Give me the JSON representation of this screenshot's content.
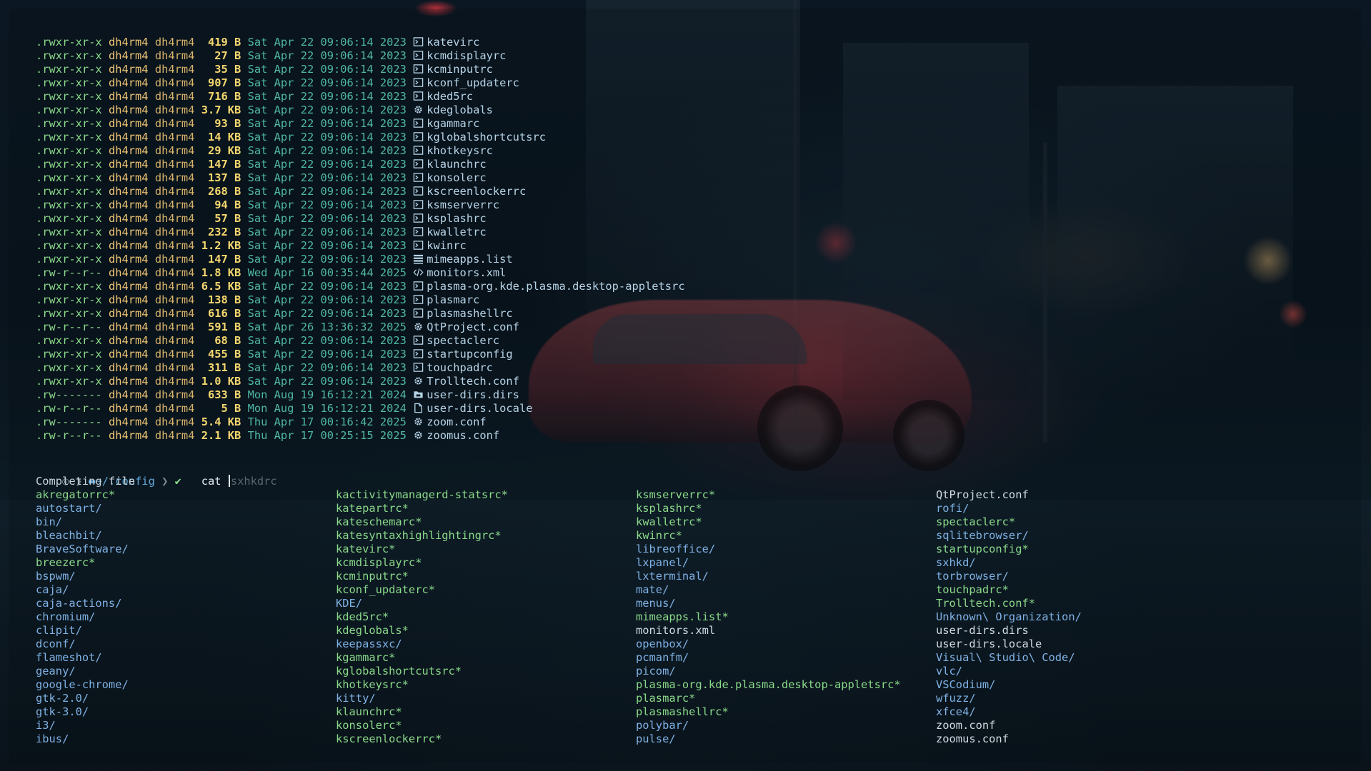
{
  "listing": [
    {
      "perm": ".rwxr-xr-x",
      "user": "dh4rm4",
      "group": "dh4rm4",
      "size": "419 B",
      "date": "Sat Apr 22 09:06:14 2023",
      "icon": "terminal-file-icon",
      "name": "katevirc"
    },
    {
      "perm": ".rwxr-xr-x",
      "user": "dh4rm4",
      "group": "dh4rm4",
      "size": " 27 B",
      "date": "Sat Apr 22 09:06:14 2023",
      "icon": "terminal-file-icon",
      "name": "kcmdisplayrc"
    },
    {
      "perm": ".rwxr-xr-x",
      "user": "dh4rm4",
      "group": "dh4rm4",
      "size": " 35 B",
      "date": "Sat Apr 22 09:06:14 2023",
      "icon": "terminal-file-icon",
      "name": "kcminputrc"
    },
    {
      "perm": ".rwxr-xr-x",
      "user": "dh4rm4",
      "group": "dh4rm4",
      "size": "907 B",
      "date": "Sat Apr 22 09:06:14 2023",
      "icon": "terminal-file-icon",
      "name": "kconf_updaterc"
    },
    {
      "perm": ".rwxr-xr-x",
      "user": "dh4rm4",
      "group": "dh4rm4",
      "size": "716 B",
      "date": "Sat Apr 22 09:06:14 2023",
      "icon": "terminal-file-icon",
      "name": "kded5rc"
    },
    {
      "perm": ".rwxr-xr-x",
      "user": "dh4rm4",
      "group": "dh4rm4",
      "size": "3.7 KB",
      "date": "Sat Apr 22 09:06:14 2023",
      "icon": "gear-icon",
      "name": "kdeglobals"
    },
    {
      "perm": ".rwxr-xr-x",
      "user": "dh4rm4",
      "group": "dh4rm4",
      "size": " 93 B",
      "date": "Sat Apr 22 09:06:14 2023",
      "icon": "terminal-file-icon",
      "name": "kgammarc"
    },
    {
      "perm": ".rwxr-xr-x",
      "user": "dh4rm4",
      "group": "dh4rm4",
      "size": " 14 KB",
      "date": "Sat Apr 22 09:06:14 2023",
      "icon": "terminal-file-icon",
      "name": "kglobalshortcutsrc"
    },
    {
      "perm": ".rwxr-xr-x",
      "user": "dh4rm4",
      "group": "dh4rm4",
      "size": " 29 KB",
      "date": "Sat Apr 22 09:06:14 2023",
      "icon": "terminal-file-icon",
      "name": "khotkeysrc"
    },
    {
      "perm": ".rwxr-xr-x",
      "user": "dh4rm4",
      "group": "dh4rm4",
      "size": "147 B",
      "date": "Sat Apr 22 09:06:14 2023",
      "icon": "terminal-file-icon",
      "name": "klaunchrc"
    },
    {
      "perm": ".rwxr-xr-x",
      "user": "dh4rm4",
      "group": "dh4rm4",
      "size": "137 B",
      "date": "Sat Apr 22 09:06:14 2023",
      "icon": "terminal-file-icon",
      "name": "konsolerc"
    },
    {
      "perm": ".rwxr-xr-x",
      "user": "dh4rm4",
      "group": "dh4rm4",
      "size": "268 B",
      "date": "Sat Apr 22 09:06:14 2023",
      "icon": "terminal-file-icon",
      "name": "kscreenlockerrc"
    },
    {
      "perm": ".rwxr-xr-x",
      "user": "dh4rm4",
      "group": "dh4rm4",
      "size": " 94 B",
      "date": "Sat Apr 22 09:06:14 2023",
      "icon": "terminal-file-icon",
      "name": "ksmserverrc"
    },
    {
      "perm": ".rwxr-xr-x",
      "user": "dh4rm4",
      "group": "dh4rm4",
      "size": " 57 B",
      "date": "Sat Apr 22 09:06:14 2023",
      "icon": "terminal-file-icon",
      "name": "ksplashrc"
    },
    {
      "perm": ".rwxr-xr-x",
      "user": "dh4rm4",
      "group": "dh4rm4",
      "size": "232 B",
      "date": "Sat Apr 22 09:06:14 2023",
      "icon": "terminal-file-icon",
      "name": "kwalletrc"
    },
    {
      "perm": ".rwxr-xr-x",
      "user": "dh4rm4",
      "group": "dh4rm4",
      "size": "1.2 KB",
      "date": "Sat Apr 22 09:06:14 2023",
      "icon": "terminal-file-icon",
      "name": "kwinrc"
    },
    {
      "perm": ".rwxr-xr-x",
      "user": "dh4rm4",
      "group": "dh4rm4",
      "size": "147 B",
      "date": "Sat Apr 22 09:06:14 2023",
      "icon": "list-icon",
      "name": "mimeapps.list"
    },
    {
      "perm": ".rw-r--r--",
      "user": "dh4rm4",
      "group": "dh4rm4",
      "size": "1.8 KB",
      "date": "Wed Apr 16 00:35:44 2025",
      "icon": "code-icon",
      "name": "monitors.xml"
    },
    {
      "perm": ".rwxr-xr-x",
      "user": "dh4rm4",
      "group": "dh4rm4",
      "size": "6.5 KB",
      "date": "Sat Apr 22 09:06:14 2023",
      "icon": "terminal-file-icon",
      "name": "plasma-org.kde.plasma.desktop-appletsrc"
    },
    {
      "perm": ".rwxr-xr-x",
      "user": "dh4rm4",
      "group": "dh4rm4",
      "size": "138 B",
      "date": "Sat Apr 22 09:06:14 2023",
      "icon": "terminal-file-icon",
      "name": "plasmarc"
    },
    {
      "perm": ".rwxr-xr-x",
      "user": "dh4rm4",
      "group": "dh4rm4",
      "size": "616 B",
      "date": "Sat Apr 22 09:06:14 2023",
      "icon": "terminal-file-icon",
      "name": "plasmashellrc"
    },
    {
      "perm": ".rw-r--r--",
      "user": "dh4rm4",
      "group": "dh4rm4",
      "size": "591 B",
      "date": "Sat Apr 26 13:36:32 2025",
      "icon": "gear-icon",
      "name": "QtProject.conf"
    },
    {
      "perm": ".rwxr-xr-x",
      "user": "dh4rm4",
      "group": "dh4rm4",
      "size": " 68 B",
      "date": "Sat Apr 22 09:06:14 2023",
      "icon": "terminal-file-icon",
      "name": "spectaclerc"
    },
    {
      "perm": ".rwxr-xr-x",
      "user": "dh4rm4",
      "group": "dh4rm4",
      "size": "455 B",
      "date": "Sat Apr 22 09:06:14 2023",
      "icon": "terminal-file-icon",
      "name": "startupconfig"
    },
    {
      "perm": ".rwxr-xr-x",
      "user": "dh4rm4",
      "group": "dh4rm4",
      "size": "311 B",
      "date": "Sat Apr 22 09:06:14 2023",
      "icon": "terminal-file-icon",
      "name": "touchpadrc"
    },
    {
      "perm": ".rwxr-xr-x",
      "user": "dh4rm4",
      "group": "dh4rm4",
      "size": "1.0 KB",
      "date": "Sat Apr 22 09:06:14 2023",
      "icon": "gear-icon",
      "name": "Trolltech.conf"
    },
    {
      "perm": ".rw-------",
      "user": "dh4rm4",
      "group": "dh4rm4",
      "size": "633 B",
      "date": "Mon Aug 19 16:12:21 2024",
      "icon": "folder-file-icon",
      "name": "user-dirs.dirs"
    },
    {
      "perm": ".rw-r--r--",
      "user": "dh4rm4",
      "group": "dh4rm4",
      "size": "  5 B",
      "date": "Mon Aug 19 16:12:21 2024",
      "icon": "document-icon",
      "name": "user-dirs.locale"
    },
    {
      "perm": ".rw-------",
      "user": "dh4rm4",
      "group": "dh4rm4",
      "size": "5.4 KB",
      "date": "Thu Apr 17 00:16:42 2025",
      "icon": "gear-icon",
      "name": "zoom.conf"
    },
    {
      "perm": ".rw-r--r--",
      "user": "dh4rm4",
      "group": "dh4rm4",
      "size": "2.1 KB",
      "date": "Thu Apr 17 00:25:15 2025",
      "icon": "gear-icon",
      "name": "zoomus.conf"
    }
  ],
  "prompt": {
    "path": "~/.config",
    "status": "✔",
    "command": "cat ",
    "suggestion": "sxhkdrc"
  },
  "completion": {
    "header": "Completing file",
    "columns": [
      [
        {
          "t": "akregatorrc*",
          "k": "exec"
        },
        {
          "t": "autostart/",
          "k": "dir"
        },
        {
          "t": "bin/",
          "k": "dir"
        },
        {
          "t": "bleachbit/",
          "k": "dir"
        },
        {
          "t": "BraveSoftware/",
          "k": "dir"
        },
        {
          "t": "breezerc*",
          "k": "exec"
        },
        {
          "t": "bspwm/",
          "k": "dir"
        },
        {
          "t": "caja/",
          "k": "dir"
        },
        {
          "t": "caja-actions/",
          "k": "dir"
        },
        {
          "t": "chromium/",
          "k": "dir"
        },
        {
          "t": "clipit/",
          "k": "dir"
        },
        {
          "t": "dconf/",
          "k": "dir"
        },
        {
          "t": "flameshot/",
          "k": "dir"
        },
        {
          "t": "geany/",
          "k": "dir"
        },
        {
          "t": "google-chrome/",
          "k": "dir"
        },
        {
          "t": "gtk-2.0/",
          "k": "dir"
        },
        {
          "t": "gtk-3.0/",
          "k": "dir"
        },
        {
          "t": "i3/",
          "k": "dir"
        },
        {
          "t": "ibus/",
          "k": "dir"
        }
      ],
      [
        {
          "t": "kactivitymanagerd-statsrc*",
          "k": "exec"
        },
        {
          "t": "katepartrc*",
          "k": "exec"
        },
        {
          "t": "kateschemarc*",
          "k": "exec"
        },
        {
          "t": "katesyntaxhighlightingrc*",
          "k": "exec"
        },
        {
          "t": "katevirc*",
          "k": "exec"
        },
        {
          "t": "kcmdisplayrc*",
          "k": "exec"
        },
        {
          "t": "kcminputrc*",
          "k": "exec"
        },
        {
          "t": "kconf_updaterc*",
          "k": "exec"
        },
        {
          "t": "KDE/",
          "k": "dir"
        },
        {
          "t": "kded5rc*",
          "k": "exec"
        },
        {
          "t": "kdeglobals*",
          "k": "exec"
        },
        {
          "t": "keepassxc/",
          "k": "dir"
        },
        {
          "t": "kgammarc*",
          "k": "exec"
        },
        {
          "t": "kglobalshortcutsrc*",
          "k": "exec"
        },
        {
          "t": "khotkeysrc*",
          "k": "exec"
        },
        {
          "t": "kitty/",
          "k": "dir"
        },
        {
          "t": "klaunchrc*",
          "k": "exec"
        },
        {
          "t": "konsolerc*",
          "k": "exec"
        },
        {
          "t": "kscreenlockerrc*",
          "k": "exec"
        }
      ],
      [
        {
          "t": "ksmserverrc*",
          "k": "exec"
        },
        {
          "t": "ksplashrc*",
          "k": "exec"
        },
        {
          "t": "kwalletrc*",
          "k": "exec"
        },
        {
          "t": "kwinrc*",
          "k": "exec"
        },
        {
          "t": "libreoffice/",
          "k": "dir"
        },
        {
          "t": "lxpanel/",
          "k": "dir"
        },
        {
          "t": "lxterminal/",
          "k": "dir"
        },
        {
          "t": "mate/",
          "k": "dir"
        },
        {
          "t": "menus/",
          "k": "dir"
        },
        {
          "t": "mimeapps.list*",
          "k": "exec"
        },
        {
          "t": "monitors.xml",
          "k": "file"
        },
        {
          "t": "openbox/",
          "k": "dir"
        },
        {
          "t": "pcmanfm/",
          "k": "dir"
        },
        {
          "t": "picom/",
          "k": "dir"
        },
        {
          "t": "plasma-org.kde.plasma.desktop-appletsrc*",
          "k": "exec"
        },
        {
          "t": "plasmarc*",
          "k": "exec"
        },
        {
          "t": "plasmashellrc*",
          "k": "exec"
        },
        {
          "t": "polybar/",
          "k": "dir"
        },
        {
          "t": "pulse/",
          "k": "dir"
        }
      ],
      [
        {
          "t": "QtProject.conf",
          "k": "file"
        },
        {
          "t": "rofi/",
          "k": "dir"
        },
        {
          "t": "spectaclerc*",
          "k": "exec"
        },
        {
          "t": "sqlitebrowser/",
          "k": "dir"
        },
        {
          "t": "startupconfig*",
          "k": "exec"
        },
        {
          "t": "sxhkd/",
          "k": "dir"
        },
        {
          "t": "torbrowser/",
          "k": "dir"
        },
        {
          "t": "touchpadrc*",
          "k": "exec"
        },
        {
          "t": "Trolltech.conf*",
          "k": "exec"
        },
        {
          "t": "Unknown\\ Organization/",
          "k": "dir"
        },
        {
          "t": "user-dirs.dirs",
          "k": "file"
        },
        {
          "t": "user-dirs.locale",
          "k": "file"
        },
        {
          "t": "Visual\\ Studio\\ Code/",
          "k": "dir"
        },
        {
          "t": "vlc/",
          "k": "dir"
        },
        {
          "t": "VSCodium/",
          "k": "dir"
        },
        {
          "t": "wfuzz/",
          "k": "dir"
        },
        {
          "t": "xfce4/",
          "k": "dir"
        },
        {
          "t": "zoom.conf",
          "k": "file"
        },
        {
          "t": "zoomus.conf",
          "k": "file"
        }
      ]
    ]
  }
}
